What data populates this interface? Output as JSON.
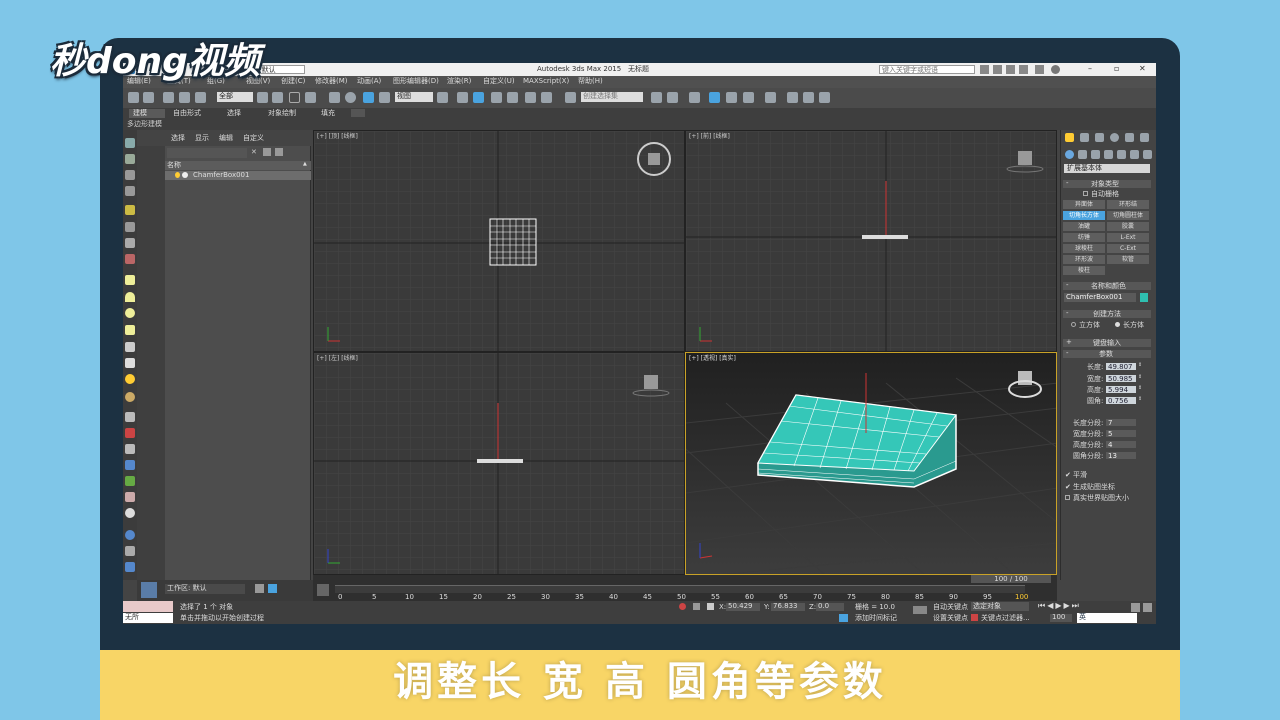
{
  "logo": "秒dong视频",
  "titlebar": {
    "workspace": "工作区: 默认",
    "title": "Autodesk 3ds Max 2015",
    "doc": "无标题",
    "search_placeholder": "键入关键字或短语"
  },
  "menu": [
    "编辑(E)",
    "工具(T)",
    "组(G)",
    "视图(V)",
    "创建(C)",
    "修改器(M)",
    "动画(A)",
    "图形编辑器(D)",
    "渲染(R)",
    "自定义(U)",
    "MAXScript(X)",
    "帮助(H)"
  ],
  "toolbar": {
    "select_filter": "全部",
    "ref_coord": "视图",
    "named_sel": "创建选择集"
  },
  "ribbon": {
    "tabs": [
      "建模",
      "自由形式",
      "选择",
      "对象绘制",
      "填充"
    ],
    "sub": "多边形建模"
  },
  "scene": {
    "menu": [
      "选择",
      "显示",
      "编辑",
      "自定义"
    ],
    "header": "名称",
    "item": "ChamferBox001"
  },
  "viewports": {
    "top": "[+] [顶] [线框]",
    "front": "[+] [前] [线框]",
    "left": "[+] [左] [线框]",
    "persp": "[+] [透视] [真实]"
  },
  "cmd": {
    "dropdown": "扩展基本体",
    "object_type": "对象类型",
    "auto_grid": "自动栅格",
    "objects": [
      "异面体",
      "环形结",
      "切角长方体",
      "切角圆柱体",
      "油罐",
      "胶囊",
      "纺锤",
      "L-Ext",
      "球棱柱",
      "C-Ext",
      "环形波",
      "软管",
      "棱柱"
    ],
    "name_color": "名称和颜色",
    "name": "ChamferBox001",
    "creation_method": "创建方法",
    "cube": "立方体",
    "box": "长方体",
    "keyboard": "键盘输入",
    "params": "参数",
    "length_label": "长度:",
    "length": "49.807",
    "width_label": "宽度:",
    "width": "50.985",
    "height_label": "高度:",
    "height": "5.994",
    "fillet_label": "圆角:",
    "fillet": "0.756",
    "lseg_label": "长度分段:",
    "lseg": "7",
    "wseg_label": "宽度分段:",
    "wseg": "5",
    "hseg_label": "高度分段:",
    "hseg": "4",
    "fseg_label": "圆角分段:",
    "fseg": "13",
    "smooth": "平滑",
    "gen_uv": "生成贴图坐标",
    "real_world": "真实世界贴图大小"
  },
  "timeline": {
    "frame": "100 / 100",
    "ticks": [
      "0",
      "5",
      "10",
      "15",
      "20",
      "25",
      "30",
      "35",
      "40",
      "45",
      "50",
      "55",
      "60",
      "65",
      "70",
      "75",
      "80",
      "85",
      "90",
      "95",
      "100"
    ]
  },
  "status": {
    "workspace": "工作区: 默认",
    "maxscript": "无所",
    "selected": "选择了 1 个 对象",
    "prompt": "单击并拖动以开始创建过程",
    "x_label": "X:",
    "x": "50.429",
    "y_label": "Y:",
    "y": "76.833",
    "z_label": "Z:",
    "z": "0.0",
    "grid": "栅格 = 10.0",
    "add_tag": "添加时间标记",
    "auto_key": "自动关键点",
    "sel_obj": "选定对象",
    "set_key": "设置关键点",
    "key_filter": "关键点过滤器...",
    "frame_field": "100",
    "ime": "英"
  },
  "caption": "调整长  宽  高  圆角等参数",
  "colors": {
    "teal": "#2fbfb0",
    "accent": "#4aa3df",
    "caption_bg": "#f8d566",
    "sky": "#7fc6e8",
    "frame": "#1c3142"
  }
}
